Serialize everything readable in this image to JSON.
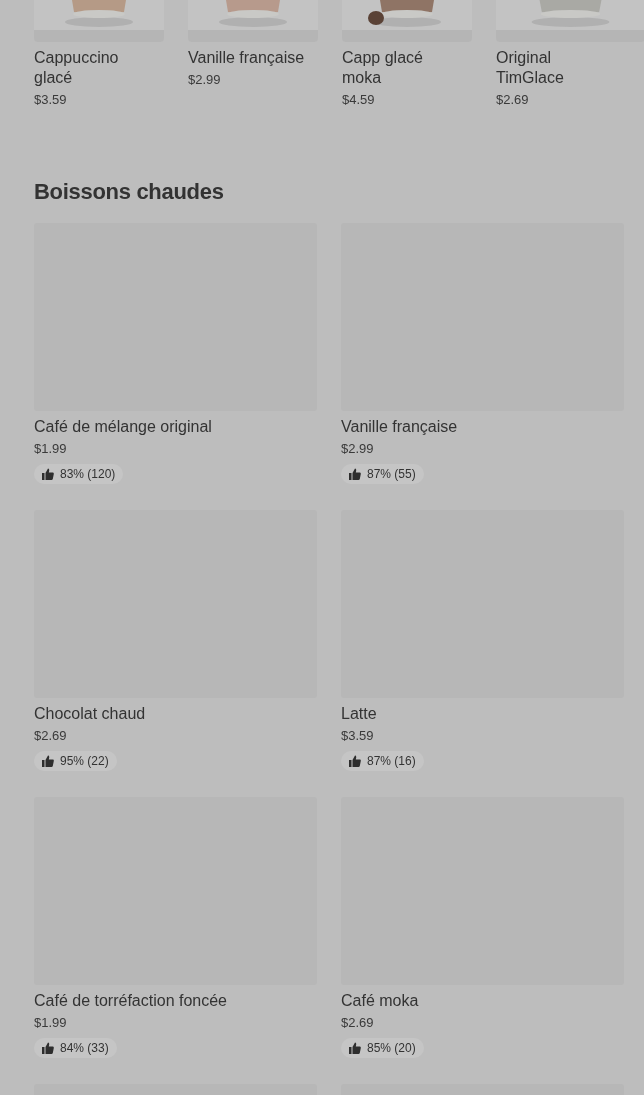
{
  "featured": [
    {
      "name": "Cappuccino glacé",
      "price": "$3.59",
      "kind": "picture"
    },
    {
      "name": "Vanille française",
      "price": "$2.99",
      "kind": "picture"
    },
    {
      "name": "Capp glacé moka",
      "price": "$4.59",
      "kind": "picture"
    },
    {
      "name": "Original TimGlace",
      "price": "$2.69",
      "kind": "picture"
    }
  ],
  "section": {
    "title": "Boissons chaudes",
    "items": [
      {
        "kind": "product",
        "name": "Café de mélange original",
        "price": "$1.99",
        "rating": "83% (120)"
      },
      {
        "kind": "product",
        "name": "Vanille française",
        "price": "$2.99",
        "rating": "87% (55)"
      },
      {
        "kind": "product",
        "name": "Chocolat chaud",
        "price": "$2.69",
        "rating": "95% (22)"
      },
      {
        "kind": "product",
        "name": "Latte",
        "price": "$3.59",
        "rating": "87% (16)"
      },
      {
        "kind": "product",
        "name": "Café de torréfaction foncée",
        "price": "$1.99",
        "rating": "84% (33)"
      },
      {
        "kind": "product",
        "name": "Café moka",
        "price": "$2.69",
        "rating": "85% (20)"
      },
      {
        "kind": "cut"
      },
      {
        "kind": "cut"
      }
    ]
  }
}
